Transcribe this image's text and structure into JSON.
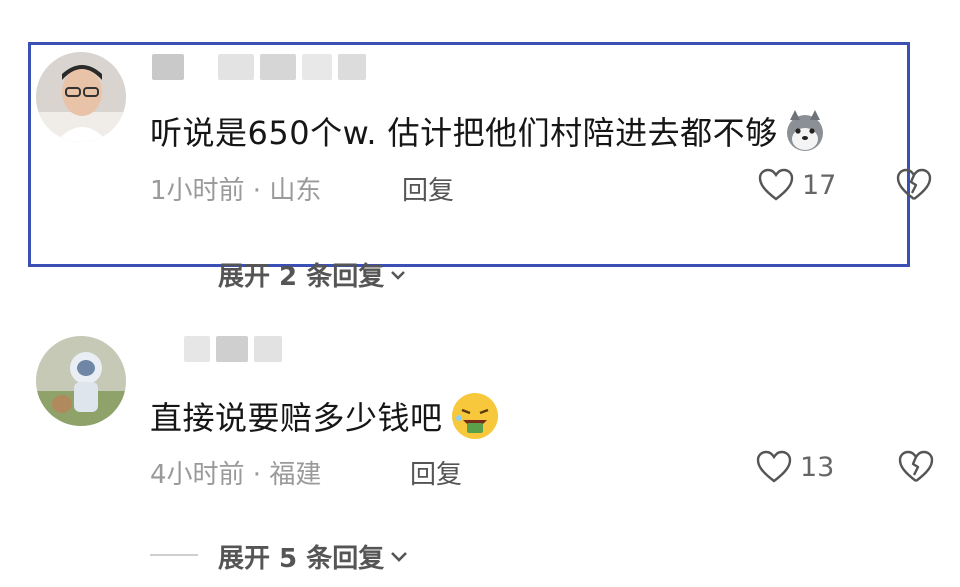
{
  "colors": {
    "highlight_border": "#3b50b5",
    "text_primary": "#161616",
    "text_meta": "#9a9a9a"
  },
  "comments": [
    {
      "text": "听说是650个w. 估计把他们村陪进去都不够",
      "emoji": "husky-dog-emoji",
      "time_location": "1小时前 · 山东",
      "reply_label": "回复",
      "likes": "17",
      "expand_label": "展开 2 条回复",
      "highlighted": true
    },
    {
      "text": "直接说要赔多少钱吧",
      "emoji": "laughing-money-emoji",
      "time_location": "4小时前 · 福建",
      "reply_label": "回复",
      "likes": "13",
      "expand_label": "展开 5 条回复",
      "highlighted": false
    }
  ]
}
